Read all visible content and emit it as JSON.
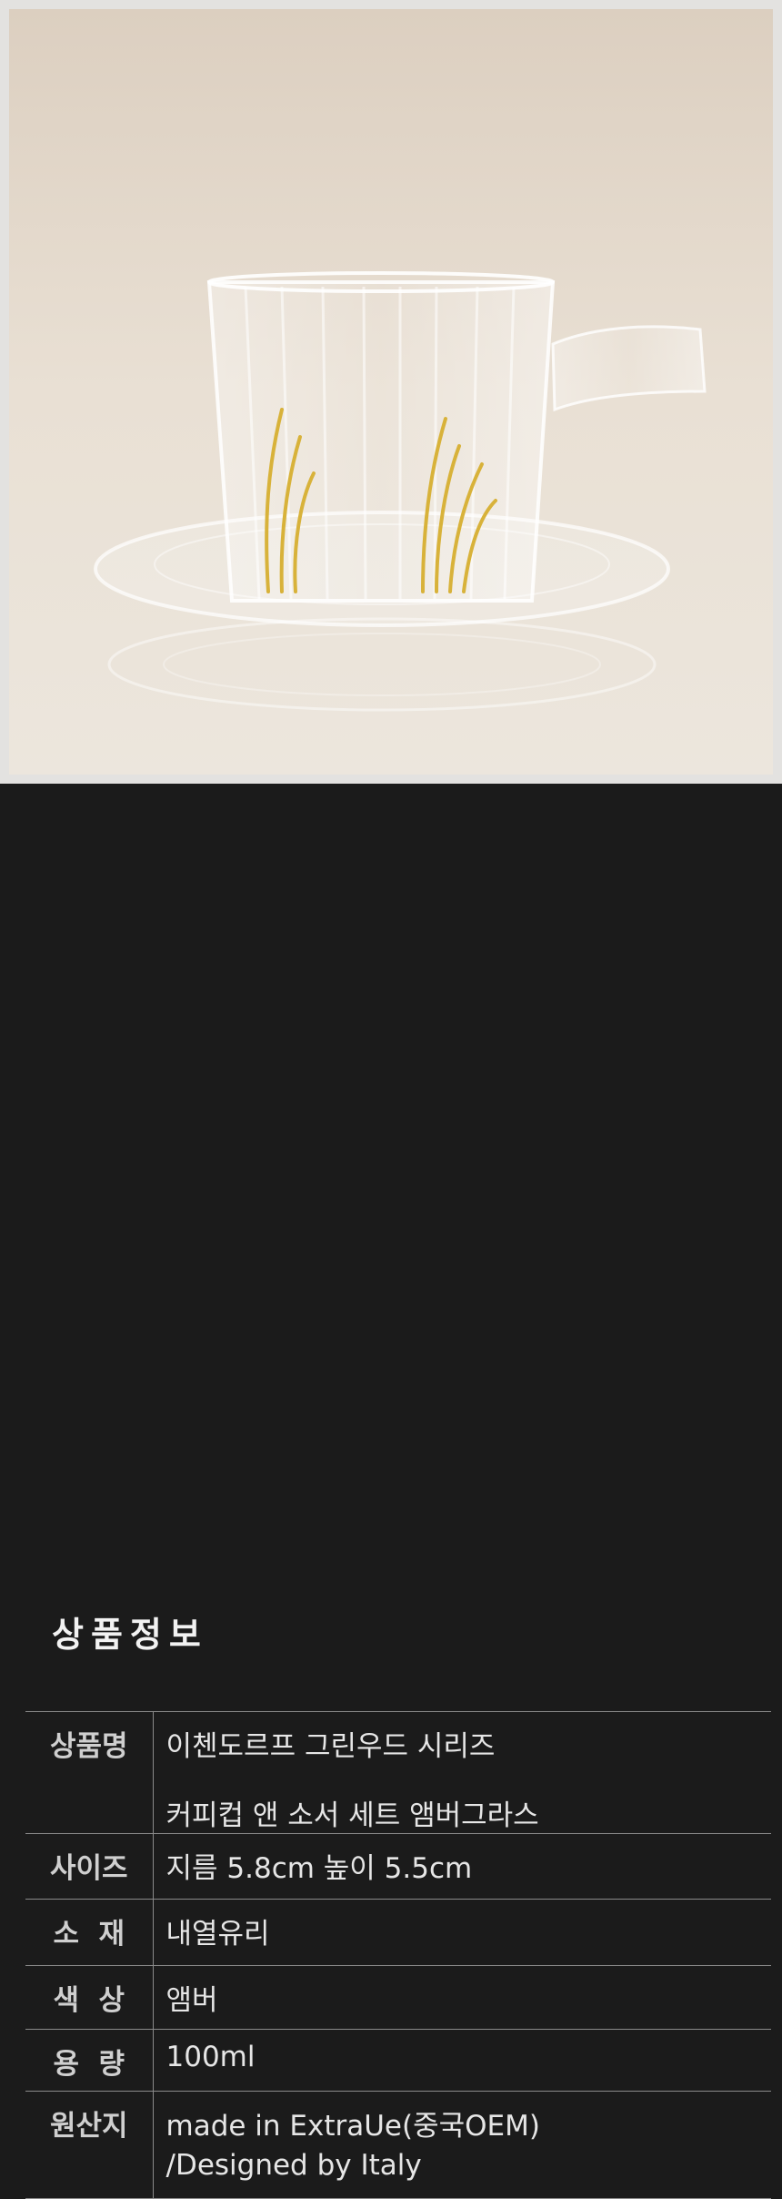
{
  "product_photo": {
    "alt": "",
    "colors": {
      "background_top": "#dccfc0",
      "background_bottom": "#ece6dd",
      "glass": "#ffffff",
      "accent_amber": "#d8b23a"
    }
  },
  "info_section": {
    "title": "상품정보"
  },
  "specs": [
    {
      "label": "상품명",
      "lines": [
        "이첸도르프 그린우드 시리즈",
        "커피컵 앤 소서 세트 앰버그라스"
      ]
    },
    {
      "label": "사이즈",
      "lines": [
        "지름 5.8cm 높이 5.5cm"
      ]
    },
    {
      "label": "소  재",
      "lines": [
        "내열유리"
      ]
    },
    {
      "label": "색  상",
      "lines": [
        "앰버"
      ]
    },
    {
      "label": "용  량",
      "lines": [
        "100ml"
      ]
    },
    {
      "label": "원산지",
      "lines": [
        "made in ExtraUe(중국OEM)",
        "/Designed by Italy"
      ]
    }
  ]
}
